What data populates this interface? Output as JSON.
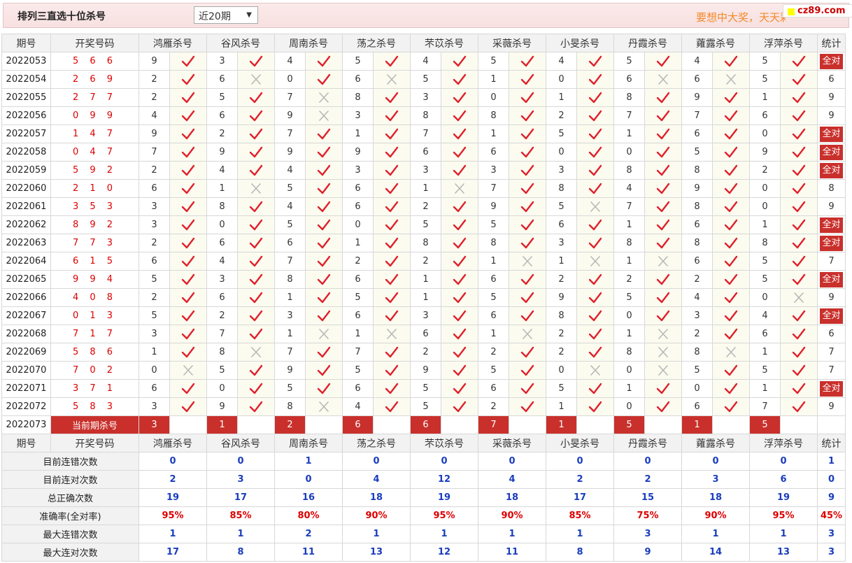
{
  "header": {
    "title": "排列三直选十位杀号",
    "period_select": "近20期",
    "slogan": "要想中大奖，天天彩经网",
    "logo": "cz89.com"
  },
  "columns": {
    "issue": "期号",
    "draw": "开奖号码",
    "experts": [
      "鸿雁杀号",
      "谷风杀号",
      "周南杀号",
      "荡之杀号",
      "芣苡杀号",
      "采薇杀号",
      "小旻杀号",
      "丹霞杀号",
      "蕹露杀号",
      "浮萍杀号"
    ],
    "stat": "统计"
  },
  "rows": [
    {
      "issue": "2022053",
      "draw": "5 6 6",
      "kills": [
        "9",
        "3",
        "4",
        "5",
        "4",
        "5",
        "4",
        "5",
        "4",
        "5"
      ],
      "results": [
        1,
        1,
        1,
        1,
        1,
        1,
        1,
        1,
        1,
        1
      ],
      "stat": "全对"
    },
    {
      "issue": "2022054",
      "draw": "2 6 9",
      "kills": [
        "2",
        "6",
        "0",
        "6",
        "5",
        "1",
        "0",
        "6",
        "6",
        "5"
      ],
      "results": [
        1,
        0,
        1,
        0,
        1,
        1,
        1,
        0,
        0,
        1
      ],
      "stat": "6"
    },
    {
      "issue": "2022055",
      "draw": "2 7 7",
      "kills": [
        "2",
        "5",
        "7",
        "8",
        "3",
        "0",
        "1",
        "8",
        "9",
        "1"
      ],
      "results": [
        1,
        1,
        0,
        1,
        1,
        1,
        1,
        1,
        1,
        1
      ],
      "stat": "9"
    },
    {
      "issue": "2022056",
      "draw": "0 9 9",
      "kills": [
        "4",
        "6",
        "9",
        "3",
        "8",
        "8",
        "2",
        "7",
        "7",
        "6"
      ],
      "results": [
        1,
        1,
        0,
        1,
        1,
        1,
        1,
        1,
        1,
        1
      ],
      "stat": "9"
    },
    {
      "issue": "2022057",
      "draw": "1 4 7",
      "kills": [
        "9",
        "2",
        "7",
        "1",
        "7",
        "1",
        "5",
        "1",
        "6",
        "0"
      ],
      "results": [
        1,
        1,
        1,
        1,
        1,
        1,
        1,
        1,
        1,
        1
      ],
      "stat": "全对"
    },
    {
      "issue": "2022058",
      "draw": "0 4 7",
      "kills": [
        "7",
        "9",
        "9",
        "9",
        "6",
        "6",
        "0",
        "0",
        "5",
        "9"
      ],
      "results": [
        1,
        1,
        1,
        1,
        1,
        1,
        1,
        1,
        1,
        1
      ],
      "stat": "全对"
    },
    {
      "issue": "2022059",
      "draw": "5 9 2",
      "kills": [
        "2",
        "4",
        "4",
        "3",
        "3",
        "3",
        "3",
        "8",
        "8",
        "2"
      ],
      "results": [
        1,
        1,
        1,
        1,
        1,
        1,
        1,
        1,
        1,
        1
      ],
      "stat": "全对"
    },
    {
      "issue": "2022060",
      "draw": "2 1 0",
      "kills": [
        "6",
        "1",
        "5",
        "6",
        "1",
        "7",
        "8",
        "4",
        "9",
        "0"
      ],
      "results": [
        1,
        0,
        1,
        1,
        0,
        1,
        1,
        1,
        1,
        1
      ],
      "stat": "8"
    },
    {
      "issue": "2022061",
      "draw": "3 5 3",
      "kills": [
        "3",
        "8",
        "4",
        "6",
        "2",
        "9",
        "5",
        "7",
        "8",
        "0"
      ],
      "results": [
        1,
        1,
        1,
        1,
        1,
        1,
        0,
        1,
        1,
        1
      ],
      "stat": "9"
    },
    {
      "issue": "2022062",
      "draw": "8 9 2",
      "kills": [
        "3",
        "0",
        "5",
        "0",
        "5",
        "5",
        "6",
        "1",
        "6",
        "1"
      ],
      "results": [
        1,
        1,
        1,
        1,
        1,
        1,
        1,
        1,
        1,
        1
      ],
      "stat": "全对"
    },
    {
      "issue": "2022063",
      "draw": "7 7 3",
      "kills": [
        "2",
        "6",
        "6",
        "1",
        "8",
        "8",
        "3",
        "8",
        "8",
        "8"
      ],
      "results": [
        1,
        1,
        1,
        1,
        1,
        1,
        1,
        1,
        1,
        1
      ],
      "stat": "全对"
    },
    {
      "issue": "2022064",
      "draw": "6 1 5",
      "kills": [
        "6",
        "4",
        "7",
        "2",
        "2",
        "1",
        "1",
        "1",
        "6",
        "5"
      ],
      "results": [
        1,
        1,
        1,
        1,
        1,
        0,
        0,
        0,
        1,
        1
      ],
      "stat": "7"
    },
    {
      "issue": "2022065",
      "draw": "9 9 4",
      "kills": [
        "5",
        "3",
        "8",
        "6",
        "1",
        "6",
        "2",
        "2",
        "2",
        "5"
      ],
      "results": [
        1,
        1,
        1,
        1,
        1,
        1,
        1,
        1,
        1,
        1
      ],
      "stat": "全对"
    },
    {
      "issue": "2022066",
      "draw": "4 0 8",
      "kills": [
        "2",
        "6",
        "1",
        "5",
        "1",
        "5",
        "9",
        "5",
        "4",
        "0"
      ],
      "results": [
        1,
        1,
        1,
        1,
        1,
        1,
        1,
        1,
        1,
        0
      ],
      "stat": "9"
    },
    {
      "issue": "2022067",
      "draw": "0 1 3",
      "kills": [
        "5",
        "2",
        "3",
        "6",
        "3",
        "6",
        "8",
        "0",
        "3",
        "4"
      ],
      "results": [
        1,
        1,
        1,
        1,
        1,
        1,
        1,
        1,
        1,
        1
      ],
      "stat": "全对"
    },
    {
      "issue": "2022068",
      "draw": "7 1 7",
      "kills": [
        "3",
        "7",
        "1",
        "1",
        "6",
        "1",
        "2",
        "1",
        "2",
        "6"
      ],
      "results": [
        1,
        1,
        0,
        0,
        1,
        0,
        1,
        0,
        1,
        1
      ],
      "stat": "6"
    },
    {
      "issue": "2022069",
      "draw": "5 8 6",
      "kills": [
        "1",
        "8",
        "7",
        "7",
        "2",
        "2",
        "2",
        "8",
        "8",
        "1"
      ],
      "results": [
        1,
        0,
        1,
        1,
        1,
        1,
        1,
        0,
        0,
        1
      ],
      "stat": "7"
    },
    {
      "issue": "2022070",
      "draw": "7 0 2",
      "kills": [
        "0",
        "5",
        "9",
        "5",
        "9",
        "5",
        "0",
        "0",
        "5",
        "5"
      ],
      "results": [
        0,
        1,
        1,
        1,
        1,
        1,
        0,
        0,
        1,
        1
      ],
      "stat": "7"
    },
    {
      "issue": "2022071",
      "draw": "3 7 1",
      "kills": [
        "6",
        "0",
        "5",
        "6",
        "5",
        "6",
        "5",
        "1",
        "0",
        "1"
      ],
      "results": [
        1,
        1,
        1,
        1,
        1,
        1,
        1,
        1,
        1,
        1
      ],
      "stat": "全对"
    },
    {
      "issue": "2022072",
      "draw": "5 8 3",
      "kills": [
        "3",
        "9",
        "8",
        "4",
        "5",
        "2",
        "1",
        "0",
        "6",
        "7"
      ],
      "results": [
        1,
        1,
        0,
        1,
        1,
        1,
        1,
        1,
        1,
        1
      ],
      "stat": "9"
    }
  ],
  "current": {
    "issue": "2022073",
    "label": "当前期杀号",
    "kills": [
      "3",
      "1",
      "2",
      "6",
      "6",
      "7",
      "1",
      "5",
      "1",
      "5"
    ]
  },
  "summary": [
    {
      "label": "目前连错次数",
      "values": [
        "0",
        "0",
        "1",
        "0",
        "0",
        "0",
        "0",
        "0",
        "0",
        "0"
      ],
      "stat": "1"
    },
    {
      "label": "目前连对次数",
      "values": [
        "2",
        "3",
        "0",
        "4",
        "12",
        "4",
        "2",
        "2",
        "3",
        "6"
      ],
      "stat": "0"
    },
    {
      "label": "总正确次数",
      "values": [
        "19",
        "17",
        "16",
        "18",
        "19",
        "18",
        "17",
        "15",
        "18",
        "19"
      ],
      "stat": "9"
    },
    {
      "label": "准确率(全对率)",
      "values": [
        "95%",
        "85%",
        "80%",
        "90%",
        "95%",
        "90%",
        "85%",
        "75%",
        "90%",
        "95%"
      ],
      "stat": "45%",
      "percent": true
    },
    {
      "label": "最大连错次数",
      "values": [
        "1",
        "1",
        "2",
        "1",
        "1",
        "1",
        "1",
        "3",
        "1",
        "1"
      ],
      "stat": "3"
    },
    {
      "label": "最大连对次数",
      "values": [
        "17",
        "8",
        "11",
        "13",
        "12",
        "11",
        "8",
        "9",
        "14",
        "13"
      ],
      "stat": "3"
    }
  ],
  "colors": {
    "hit": "#e0202a",
    "miss": "#b8b8b8",
    "accent": "#c9302c",
    "summary_value": "#1a3dbd"
  }
}
